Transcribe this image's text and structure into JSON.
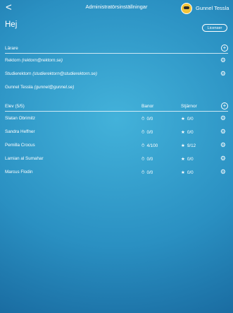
{
  "header": {
    "back": "<",
    "title": "Administratörsinställningar",
    "user": "Gunnel Tessla"
  },
  "greeting": "Hej",
  "licenser_label": "Licenser",
  "teachers": {
    "heading": "Lärare",
    "items": [
      {
        "role": "Rektorn",
        "email": "(rektorn@rektorn.se)"
      },
      {
        "role": "Studierektorn",
        "email": "(studierektorn@studierektorn.se)"
      },
      {
        "role": "Gunnel Tessla",
        "email": "(gunnel@gunnel.se)"
      }
    ]
  },
  "students": {
    "heading": "Elev (5/5)",
    "col_banor": "Banor",
    "col_stjarnor": "Stjärnor",
    "items": [
      {
        "name": "Slatan Obrimitz",
        "banor": "0/0",
        "stjarnor": "0/0"
      },
      {
        "name": "Sandra Heffner",
        "banor": "0/0",
        "stjarnor": "0/0"
      },
      {
        "name": "Pernilla Crocus",
        "banor": "4/100",
        "stjarnor": "9/12"
      },
      {
        "name": "Lamian al Sumahar",
        "banor": "0/0",
        "stjarnor": "0/0"
      },
      {
        "name": "Marcus Flodin",
        "banor": "0/0",
        "stjarnor": "0/0"
      }
    ]
  },
  "icons": {
    "back": "chevron-left-icon",
    "avatar": "user-avatar",
    "add": "plus-circle-icon",
    "settings": "gear-icon",
    "tracks": "track-icon",
    "stars": "star-icon"
  },
  "colors": {
    "bg_light": "#43b2da",
    "bg_dark": "#125a8e",
    "avatar": "#f2c43a"
  }
}
